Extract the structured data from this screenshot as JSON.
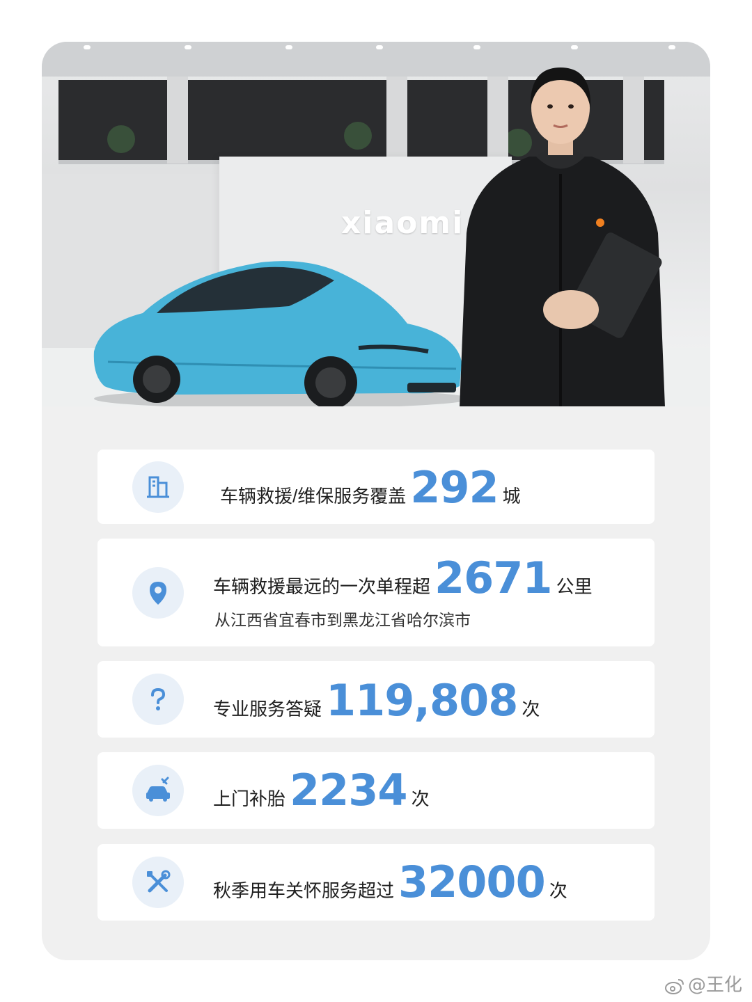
{
  "hero": {
    "wall_logo": "xiaomi"
  },
  "stats": [
    {
      "icon": "building-icon",
      "label": "车辆救援/维保服务覆盖",
      "value": "292",
      "unit": "城"
    },
    {
      "icon": "location-pin-icon",
      "label": "车辆救援最远的一次单程超",
      "value": "2671",
      "unit": "公里",
      "sub": "从江西省宜春市到黑龙江省哈尔滨市"
    },
    {
      "icon": "question-icon",
      "label": "专业服务答疑",
      "value": "119,808",
      "unit": "次"
    },
    {
      "icon": "car-repair-icon",
      "label": "上门补胎",
      "value": "2234",
      "unit": "次"
    },
    {
      "icon": "wrench-screwdriver-icon",
      "label": "秋季用车关怀服务超过",
      "value": "32000",
      "unit": "次"
    }
  ],
  "colors": {
    "accent": "#4a8fd8",
    "icon_bg": "#e9f0f8",
    "card_bg": "#f0f0f0"
  },
  "watermark": {
    "text": "@王化"
  }
}
